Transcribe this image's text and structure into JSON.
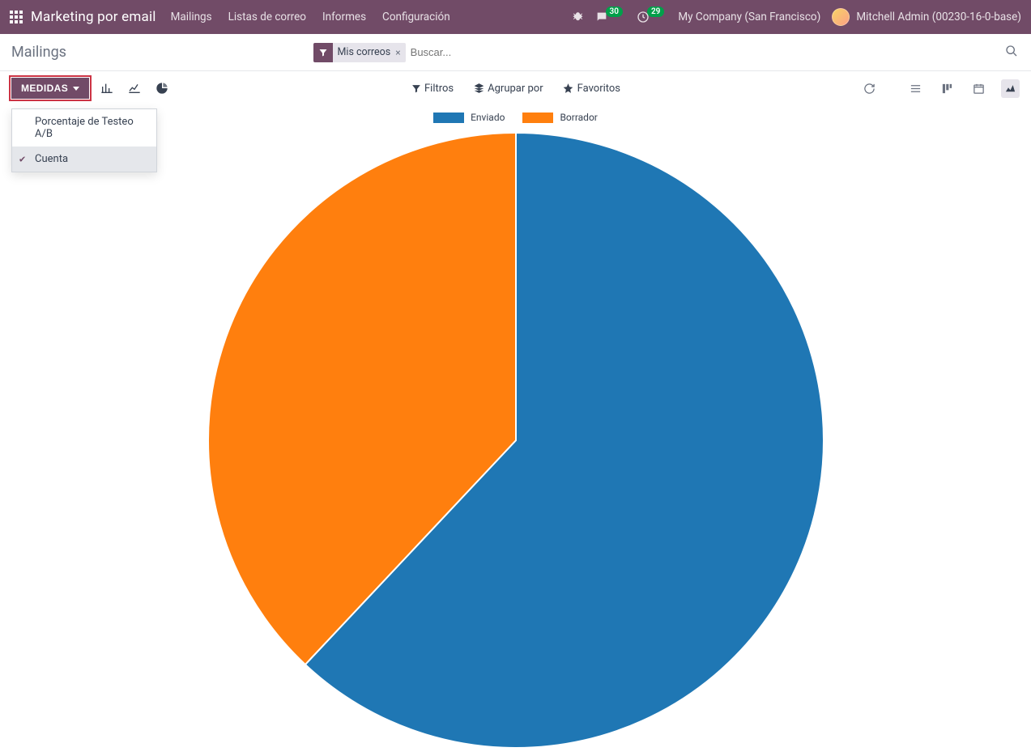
{
  "topbar": {
    "brand": "Marketing por email",
    "nav": [
      "Mailings",
      "Listas de correo",
      "Informes",
      "Configuración"
    ],
    "badge_messages": "30",
    "badge_activities": "29",
    "company": "My Company (San Francisco)",
    "user": "Mitchell Admin (00230-16-0-base)"
  },
  "breadcrumb": {
    "title": "Mailings"
  },
  "search": {
    "chip_label": "Mis correos",
    "placeholder": "Buscar..."
  },
  "toolbar": {
    "medidas_label": "MEDIDAS",
    "dropdown": {
      "item1": "Porcentaje de Testeo A/B",
      "item2": "Cuenta"
    },
    "filters_label": "Filtros",
    "groupby_label": "Agrupar por",
    "favorites_label": "Favoritos"
  },
  "chart_data": {
    "type": "pie",
    "title": "",
    "series": [
      {
        "name": "Enviado",
        "value": 62,
        "color": "#1f77b4"
      },
      {
        "name": "Borrador",
        "value": 38,
        "color": "#ff7f0e"
      }
    ]
  },
  "colors": {
    "primary": "#714B67"
  }
}
